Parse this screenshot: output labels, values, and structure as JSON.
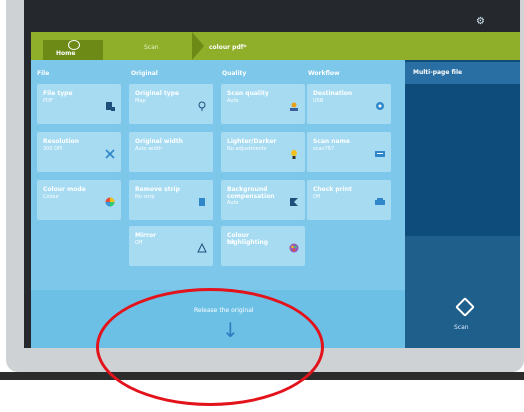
{
  "header": {
    "home_label": "Home",
    "crumb_scan": "Scan",
    "crumb_current": "colour pdf*"
  },
  "columns": [
    "File",
    "Original",
    "Quality",
    "Workflow"
  ],
  "tiles": [
    {
      "title": "File type",
      "value": "PDF",
      "icon": "document-icon"
    },
    {
      "title": "Original type",
      "value": "Map",
      "icon": "cloud-icon"
    },
    {
      "title": "Scan quality",
      "value": "Auto",
      "icon": "quality-icon"
    },
    {
      "title": "Destination",
      "value": "USB",
      "icon": "location-pin-icon"
    },
    {
      "title": "Resolution",
      "value": "300 DPI",
      "icon": "close-icon"
    },
    {
      "title": "Original width",
      "value": "Auto width",
      "icon": ""
    },
    {
      "title": "Lighter/Darker",
      "value": "No adjustments",
      "icon": "lightbulb-icon"
    },
    {
      "title": "Scan name",
      "value": "scan767",
      "icon": "keyboard-icon"
    },
    {
      "title": "Colour mode",
      "value": "Colour",
      "icon": "color-wheel-icon"
    },
    {
      "title": "Remove strip",
      "value": "No strip",
      "icon": "strip-icon"
    },
    {
      "title": "Background compensation",
      "value": "Auto",
      "icon": "flag-icon"
    },
    {
      "title": "Check print",
      "value": "Off",
      "icon": "printer-icon"
    },
    {
      "title": "Mirror",
      "value": "Off",
      "icon": "mirror-icon"
    },
    {
      "title": "Colour highlighting",
      "value": "Off",
      "icon": "palette-icon"
    }
  ],
  "side": {
    "tab_label": "Multi-page file",
    "scan_label": "Scan"
  },
  "bottom": {
    "release_label": "Release the original"
  },
  "colors": {
    "breadcrumb": "#8fae2a",
    "panel": "#7cc7ea",
    "tile": "#a6dbf1",
    "side": "#0d4c7b",
    "annotation": "#e3131b"
  }
}
